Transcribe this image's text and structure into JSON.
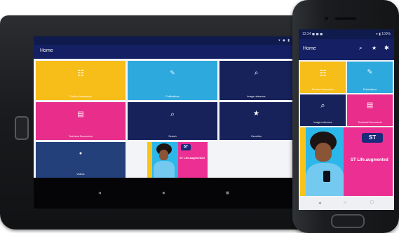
{
  "tablet": {
    "status_icons": "▾ ◆ ▮",
    "app_title": "Home",
    "tiles": [
      {
        "label": "Product Information",
        "icon": "list-icon",
        "glyph": "☷"
      },
      {
        "label": "Publications",
        "icon": "edit-icon",
        "glyph": "✎"
      },
      {
        "label": "Image reference",
        "icon": "search-icon",
        "glyph": "⌕"
      },
      {
        "label": "Technical Documents",
        "icon": "document-icon",
        "glyph": "▤"
      },
      {
        "label": "Search",
        "icon": "search-icon",
        "glyph": "⌕"
      },
      {
        "label": "Favorites",
        "icon": "star-icon",
        "glyph": "★"
      },
      {
        "label": "Videos",
        "icon": "play-icon",
        "glyph": "●"
      }
    ],
    "promo": {
      "badge": "ST",
      "headline": "ST Life.augmented"
    },
    "nav": {
      "back": "◂",
      "home": "●",
      "recents": "■"
    }
  },
  "phone": {
    "status_left": "12:34 ◼ ◼ ◼",
    "status_right": "▾ ▮ 100%",
    "app_title": "Home",
    "actions": {
      "search": "⌕",
      "favorite": "★",
      "settings": "✱"
    },
    "tiles": [
      {
        "label": "Product Information",
        "icon": "list-icon",
        "glyph": "☷"
      },
      {
        "label": "Publications",
        "icon": "edit-icon",
        "glyph": "✎"
      },
      {
        "label": "Image reference",
        "icon": "search-icon",
        "glyph": "⌕"
      },
      {
        "label": "Technical Documents",
        "icon": "document-icon",
        "glyph": "▤"
      }
    ],
    "promo": {
      "badge": "ST",
      "headline": "ST Life.augmented"
    },
    "nav": {
      "back": "◂",
      "home": "○",
      "recents": "□"
    }
  },
  "colors": {
    "yellow": "#f7bd18",
    "cyan": "#2ea9de",
    "navy": "#162259",
    "pink": "#e82d8b",
    "steel": "#23407a",
    "appbar": "#142063"
  }
}
